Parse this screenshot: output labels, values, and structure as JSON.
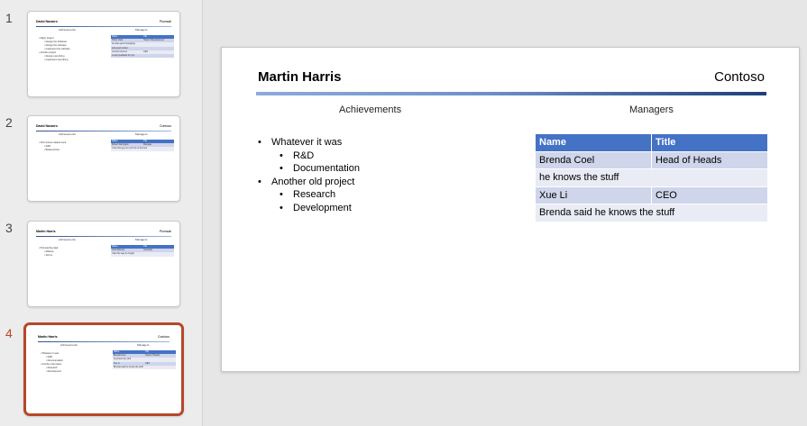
{
  "thumbnails": [
    {
      "number": "1",
      "active": false,
      "name": "David Navarro",
      "company": "Plumsail",
      "col_left": "Achievements",
      "col_right": "Managers",
      "bullets": [
        {
          "text": "Major project",
          "sub": false
        },
        {
          "text": "Design the Software",
          "sub": true
        },
        {
          "text": "Design the software",
          "sub": true
        },
        {
          "text": "Implement the software",
          "sub": true
        },
        {
          "text": "Another project",
          "sub": false
        },
        {
          "text": "Design everything",
          "sub": true
        },
        {
          "text": "Implement everything",
          "sub": true
        }
      ],
      "table": {
        "header": [
          "Name",
          "Title"
        ],
        "rows": [
          {
            "cells": [
              "Hristo Vasil",
              "Head of Development"
            ],
            "full": false
          },
          {
            "cells": [
              "he does good managing"
            ],
            "full": true
          },
          {
            "cells": [
              "and good worker"
            ],
            "full": true
          },
          {
            "cells": [
              "Lorenzo Gomez",
              "CEO"
            ],
            "full": false
          },
          {
            "cells": [
              "Lovely feedback for you"
            ],
            "full": true
          }
        ]
      }
    },
    {
      "number": "2",
      "active": false,
      "name": "David Navarro",
      "company": "Contoso",
      "col_left": "Achievements",
      "col_right": "Managers",
      "bullets": [
        {
          "text": "Old contoso related work",
          "sub": false
        },
        {
          "text": "R&D",
          "sub": true
        },
        {
          "text": "Backend Dev",
          "sub": true
        }
      ],
      "table": {
        "header": [
          "Name",
          "Title"
        ],
        "rows": [
          {
            "cells": [
              "Robert Farrington",
              "Manager"
            ],
            "full": false
          },
          {
            "cells": [
              "I love this guy so much he is the best"
            ],
            "full": true
          }
        ]
      }
    },
    {
      "number": "3",
      "active": false,
      "name": "Martin Harris",
      "company": "Plumsail",
      "col_left": "Achievements",
      "col_right": "Managers",
      "bullets": [
        {
          "text": "Plumsail big deal",
          "sub": false
        },
        {
          "text": "Alliance",
          "sub": true
        },
        {
          "text": "Scrum",
          "sub": true
        }
      ],
      "table": {
        "header": [
          "Name",
          "Title"
        ],
        "rows": [
          {
            "cells": [
              "Gina Alleman",
              "Associate"
            ],
            "full": false
          },
          {
            "cells": [
              "I like this way he fought"
            ],
            "full": true
          }
        ]
      }
    },
    {
      "number": "4",
      "active": true,
      "name": "Martin Harris",
      "company": "Contoso",
      "col_left": "Achievements",
      "col_right": "Managers",
      "bullets": [
        {
          "text": "Whatever it was",
          "sub": false
        },
        {
          "text": "R&D",
          "sub": true
        },
        {
          "text": "Documentation",
          "sub": true
        },
        {
          "text": "Another old project",
          "sub": false
        },
        {
          "text": "Research",
          "sub": true
        },
        {
          "text": "Development",
          "sub": true
        }
      ],
      "table": {
        "header": [
          "Name",
          "Title"
        ],
        "rows": [
          {
            "cells": [
              "Brenda Coel",
              "Head of Heads"
            ],
            "full": false
          },
          {
            "cells": [
              "he knows the stuff"
            ],
            "full": true
          },
          {
            "cells": [
              "Xue Li",
              "CEO"
            ],
            "full": false
          },
          {
            "cells": [
              "Brenda said he knows the stuff"
            ],
            "full": true
          }
        ]
      }
    }
  ],
  "slide": {
    "name": "Martin Harris",
    "company": "Contoso",
    "col_left": "Achievements",
    "col_right": "Managers",
    "bullets": [
      {
        "text": "Whatever it was",
        "sub": false
      },
      {
        "text": "R&D",
        "sub": true
      },
      {
        "text": "Documentation",
        "sub": true
      },
      {
        "text": "Another old project",
        "sub": false
      },
      {
        "text": "Research",
        "sub": true
      },
      {
        "text": "Development",
        "sub": true
      }
    ],
    "table": {
      "header": [
        "Name",
        "Title"
      ],
      "rows": [
        {
          "cells": [
            "Brenda Coel",
            "Head of Heads"
          ],
          "full": false
        },
        {
          "cells": [
            "he knows the stuff"
          ],
          "full": true
        },
        {
          "cells": [
            "Xue Li",
            "CEO"
          ],
          "full": false
        },
        {
          "cells": [
            "Brenda said he knows the stuff"
          ],
          "full": true
        }
      ]
    }
  },
  "colors": {
    "accent_active": "#b7472a",
    "table_header": "#4472c4",
    "table_row_a": "#cfd5ea",
    "table_row_b": "#e9ebf5"
  }
}
